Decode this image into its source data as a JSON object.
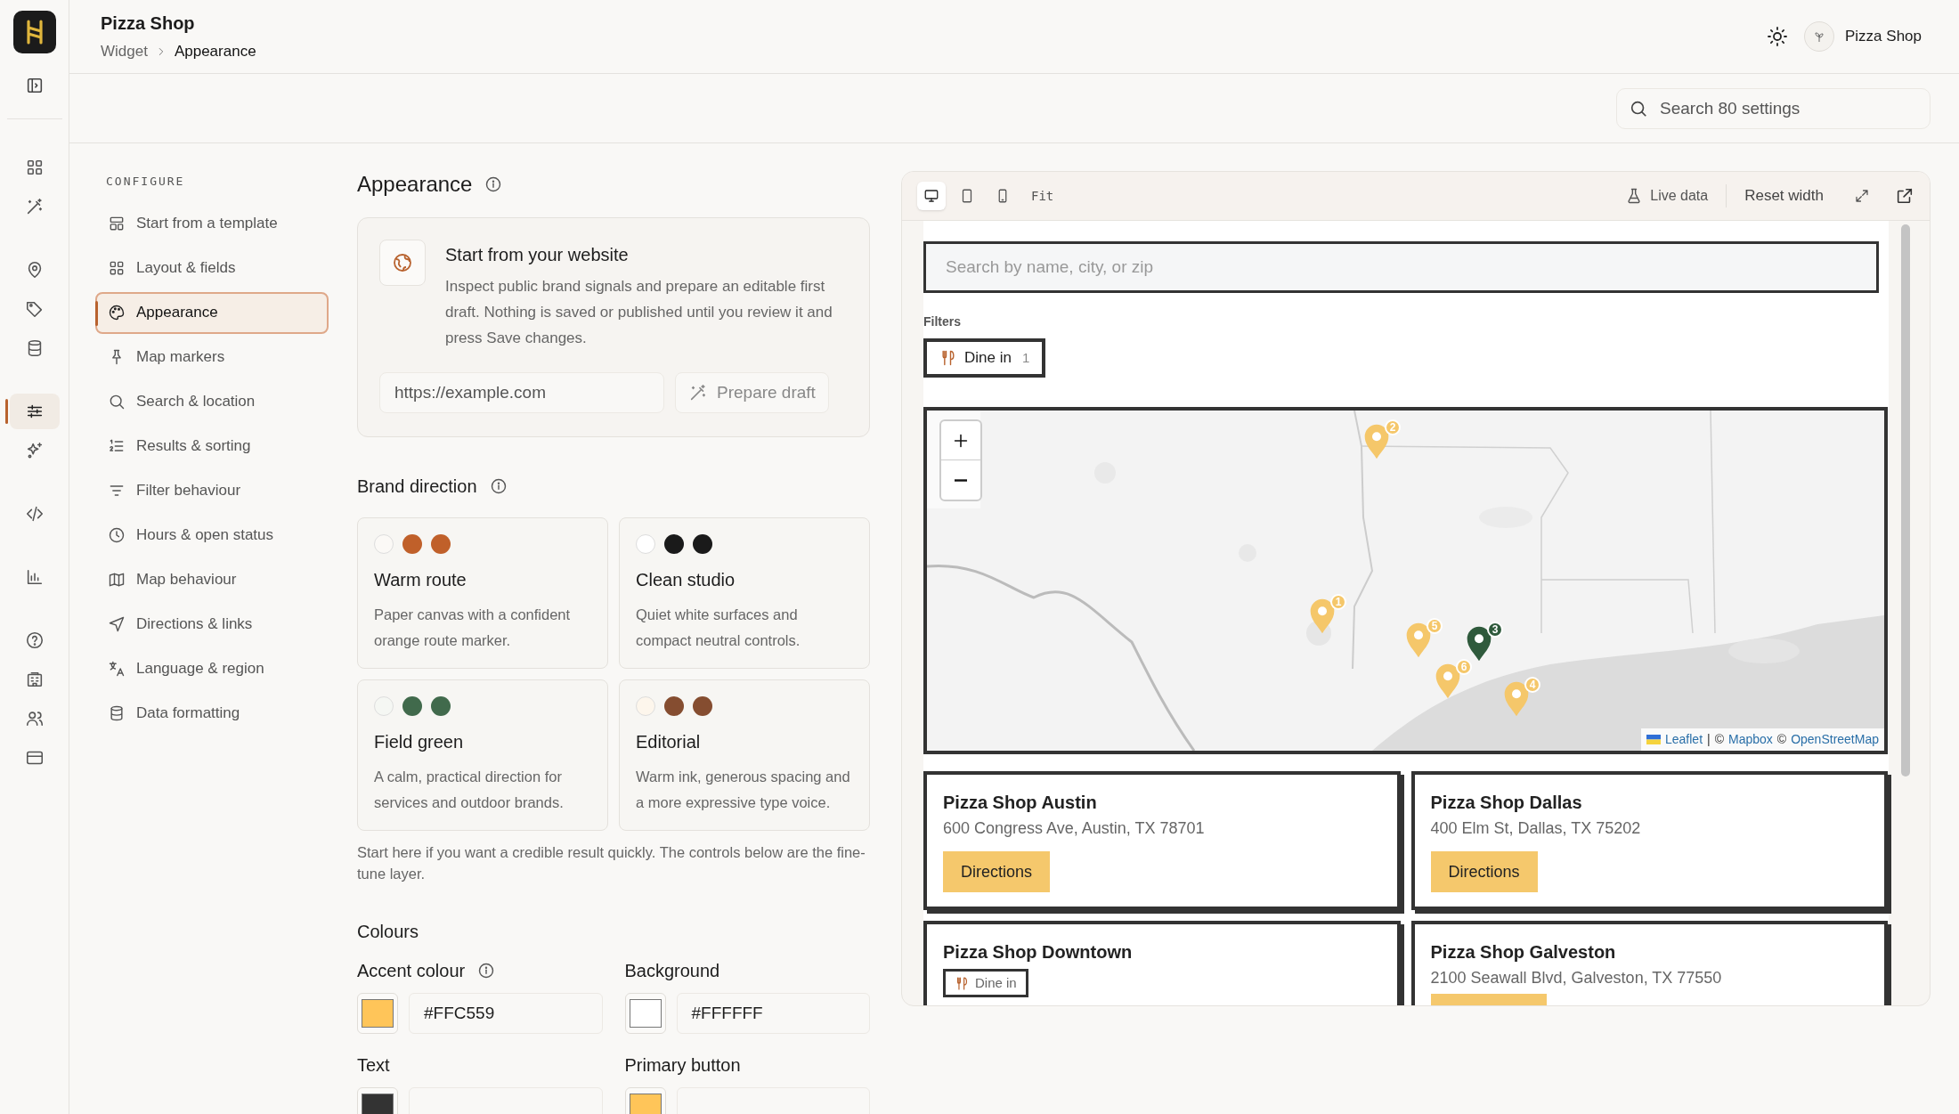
{
  "header": {
    "title": "Pizza Shop",
    "breadcrumb": [
      "Widget",
      "Appearance"
    ],
    "account": "Pizza Shop"
  },
  "rail": {
    "items": [
      {
        "selected": false
      },
      {
        "selected": false
      },
      {
        "selected": false
      },
      {
        "selected": false
      },
      {
        "selected": false
      },
      {
        "selected": true
      },
      {
        "selected": false
      },
      {
        "selected": false
      },
      {
        "selected": false
      },
      {
        "selected": false
      },
      {
        "selected": false
      },
      {
        "selected": false
      },
      {
        "selected": false
      }
    ]
  },
  "settings_search": {
    "placeholder": "Search 80 settings"
  },
  "configure": {
    "heading": "CONFIGURE",
    "items": [
      {
        "label": "Start from a template",
        "selected": false
      },
      {
        "label": "Layout & fields",
        "selected": false
      },
      {
        "label": "Appearance",
        "selected": true
      },
      {
        "label": "Map markers",
        "selected": false
      },
      {
        "label": "Search & location",
        "selected": false
      },
      {
        "label": "Results & sorting",
        "selected": false
      },
      {
        "label": "Filter behaviour",
        "selected": false
      },
      {
        "label": "Hours & open status",
        "selected": false
      },
      {
        "label": "Map behaviour",
        "selected": false
      },
      {
        "label": "Directions & links",
        "selected": false
      },
      {
        "label": "Language & region",
        "selected": false
      },
      {
        "label": "Data formatting",
        "selected": false
      }
    ]
  },
  "appearance": {
    "title": "Appearance",
    "website": {
      "title": "Start from your website",
      "description": "Inspect public brand signals and prepare an editable first draft. Nothing is saved or published until you review it and press Save changes.",
      "url_placeholder": "https://example.com",
      "button": "Prepare draft"
    },
    "brand_direction": {
      "title": "Brand direction",
      "presets": [
        {
          "name": "Warm route",
          "description": "Paper canvas with a confident orange route marker.",
          "swatches": [
            {
              "color": "#fbf9f6"
            },
            {
              "color": "#c0602a"
            },
            {
              "color": "#c0602a"
            }
          ]
        },
        {
          "name": "Clean studio",
          "description": "Quiet white surfaces and compact neutral controls.",
          "swatches": [
            {
              "color": "#ffffff"
            },
            {
              "color": "#1a1a1a"
            },
            {
              "color": "#1a1a1a"
            }
          ]
        },
        {
          "name": "Field green",
          "description": "A calm, practical direction for services and outdoor brands.",
          "swatches": [
            {
              "color": "#f5f7f3"
            },
            {
              "color": "#416a4c"
            },
            {
              "color": "#416a4c"
            }
          ]
        },
        {
          "name": "Editorial",
          "description": "Warm ink, generous spacing and a more expressive type voice.",
          "swatches": [
            {
              "color": "#fdf6ec"
            },
            {
              "color": "#854d30"
            },
            {
              "color": "#854d30"
            }
          ]
        }
      ]
    },
    "note": "Start here if you want a credible result quickly. The controls below are the fine-tune layer.",
    "colours": {
      "title": "Colours",
      "fields": [
        {
          "label": "Accent colour",
          "info": true,
          "value": "#FFC559",
          "color": "#ffc559"
        },
        {
          "label": "Background",
          "info": false,
          "value": "#FFFFFF",
          "color": "#ffffff"
        },
        {
          "label": "Text",
          "info": false,
          "color": "#333333"
        },
        {
          "label": "Primary button",
          "info": false,
          "color": "#ffc559"
        }
      ]
    }
  },
  "preview": {
    "devices": [
      {
        "selected": true
      },
      {
        "selected": false
      },
      {
        "selected": false
      }
    ],
    "fit": "Fit",
    "live_data": "Live data",
    "reset_width": "Reset width",
    "search_placeholder": "Search by name, city, or zip",
    "filters_label": "Filters",
    "filters": [
      {
        "label": "Dine in",
        "count": "1"
      }
    ],
    "map": {
      "kind": "picture",
      "markers": [
        {
          "label": "2",
          "color": "#f5c76a"
        },
        {
          "label": "1",
          "color": "#f5c76a"
        },
        {
          "label": "5",
          "color": "#f5c76a"
        },
        {
          "label": "3",
          "color": "#2f5a3c"
        },
        {
          "label": "6",
          "color": "#f5c76a"
        },
        {
          "label": "4",
          "color": "#f5c76a"
        }
      ],
      "attribution": [
        {
          "text": "Leaflet",
          "link": true
        },
        {
          "text": "|",
          "link": false
        },
        {
          "text": "©",
          "link": false
        },
        {
          "text": "Mapbox",
          "link": true
        },
        {
          "text": "©",
          "link": false
        },
        {
          "text": "OpenStreetMap",
          "link": true
        }
      ]
    },
    "locations": [
      {
        "name": "Pizza Shop Austin",
        "address": "600 Congress Ave, Austin, TX 78701",
        "button": "Directions",
        "cut_button": false
      },
      {
        "name": "Pizza Shop Dallas",
        "address": "400 Elm St, Dallas, TX 75202",
        "button": "Directions",
        "cut_button": false
      },
      {
        "name": "Pizza Shop Downtown",
        "tags": [
          "Dine in"
        ],
        "cut_button": false
      },
      {
        "name": "Pizza Shop Galveston",
        "address": "2100 Seawall Blvd, Galveston, TX 77550",
        "cut_button": true
      }
    ]
  }
}
